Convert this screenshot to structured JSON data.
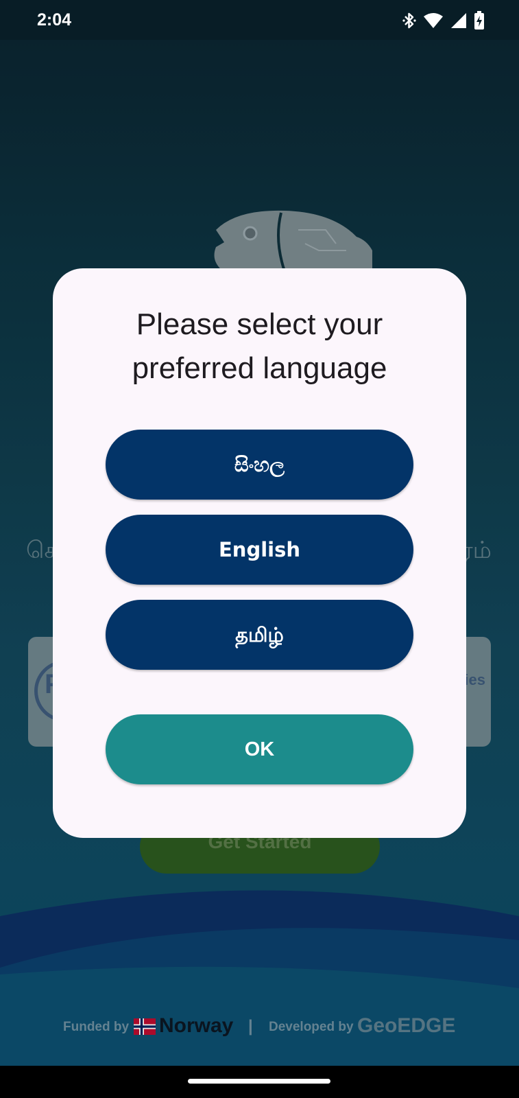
{
  "status_bar": {
    "time": "2:04",
    "icons": [
      "bluetooth-icon",
      "wifi-icon",
      "signal-icon",
      "battery-charging-icon"
    ]
  },
  "background": {
    "title_left_fragment": "செ",
    "title_right_fragment": "ரம்",
    "card_text_fragment": "ies",
    "card_logo_letter": "F",
    "get_started_label": "Get Started"
  },
  "footer": {
    "funded_by": "Funded by",
    "funder": "Norway",
    "separator": "|",
    "developed_by": "Developed by",
    "developer": "GeoEDGE"
  },
  "dialog": {
    "title_line1": "Please select your",
    "title_line2": "preferred language",
    "languages": [
      {
        "label": "සිංහල"
      },
      {
        "label": "English"
      },
      {
        "label": "தமிழ்"
      }
    ],
    "ok_label": "OK"
  },
  "colors": {
    "language_button": "#033468",
    "ok_button": "#1c8c8c",
    "dialog_bg": "#fcf6fc"
  }
}
